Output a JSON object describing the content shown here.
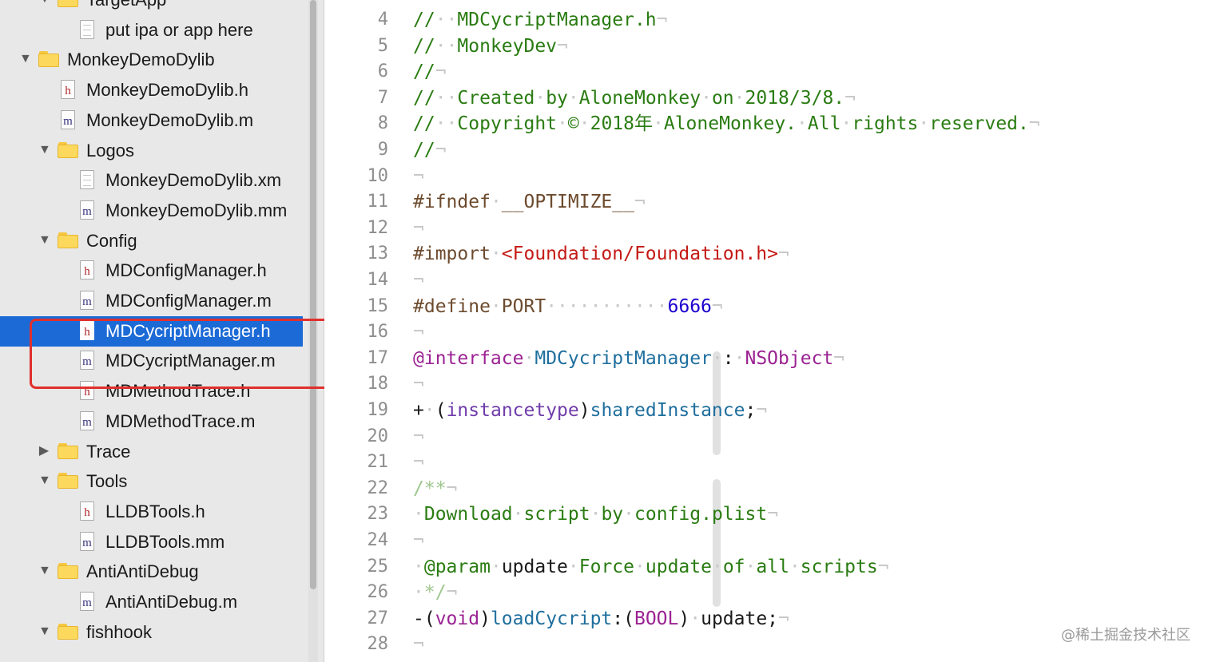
{
  "sidebar": {
    "items": [
      {
        "label": "TargetApp",
        "kind": "folder",
        "expanded": true
      },
      {
        "label": "put ipa or app here",
        "kind": "doc"
      },
      {
        "label": "MonkeyDemoDylib",
        "kind": "folder",
        "expanded": true
      },
      {
        "label": "MonkeyDemoDylib.h",
        "kind": "h",
        "glyph": "h"
      },
      {
        "label": "MonkeyDemoDylib.m",
        "kind": "m",
        "glyph": "m"
      },
      {
        "label": "Logos",
        "kind": "folder",
        "expanded": true
      },
      {
        "label": "MonkeyDemoDylib.xm",
        "kind": "doc"
      },
      {
        "label": "MonkeyDemoDylib.mm",
        "kind": "m",
        "glyph": "m"
      },
      {
        "label": "Config",
        "kind": "folder",
        "expanded": true
      },
      {
        "label": "MDConfigManager.h",
        "kind": "h",
        "glyph": "h"
      },
      {
        "label": "MDConfigManager.m",
        "kind": "m",
        "glyph": "m"
      },
      {
        "label": "MDCycriptManager.h",
        "kind": "h",
        "glyph": "h",
        "selected": true
      },
      {
        "label": "MDCycriptManager.m",
        "kind": "m",
        "glyph": "m"
      },
      {
        "label": "MDMethodTrace.h",
        "kind": "h",
        "glyph": "h"
      },
      {
        "label": "MDMethodTrace.m",
        "kind": "m",
        "glyph": "m"
      },
      {
        "label": "Trace",
        "kind": "folder",
        "expanded": false
      },
      {
        "label": "Tools",
        "kind": "folder",
        "expanded": true
      },
      {
        "label": "LLDBTools.h",
        "kind": "h",
        "glyph": "h"
      },
      {
        "label": "LLDBTools.mm",
        "kind": "m",
        "glyph": "m"
      },
      {
        "label": "AntiAntiDebug",
        "kind": "folder",
        "expanded": true
      },
      {
        "label": "AntiAntiDebug.m",
        "kind": "m",
        "glyph": "m"
      },
      {
        "label": "fishhook",
        "kind": "folder",
        "expanded": true
      }
    ],
    "disclosure": {
      "expanded": "▼",
      "collapsed": "▶"
    }
  },
  "editor": {
    "lines": [
      {
        "no": "4",
        "parts": [
          [
            "cm",
            "//"
          ],
          [
            "inv",
            "··"
          ],
          [
            "cm",
            "MDCycriptManager.h"
          ],
          [
            "inv",
            "¬"
          ]
        ]
      },
      {
        "no": "5",
        "parts": [
          [
            "cm",
            "//"
          ],
          [
            "inv",
            "··"
          ],
          [
            "cm",
            "MonkeyDev"
          ],
          [
            "inv",
            "¬"
          ]
        ]
      },
      {
        "no": "6",
        "parts": [
          [
            "cm",
            "//"
          ],
          [
            "inv",
            "¬"
          ]
        ]
      },
      {
        "no": "7",
        "parts": [
          [
            "cm",
            "//"
          ],
          [
            "inv",
            "··"
          ],
          [
            "cm",
            "Created"
          ],
          [
            "inv",
            "·"
          ],
          [
            "cm",
            "by"
          ],
          [
            "inv",
            "·"
          ],
          [
            "cm",
            "AloneMonkey"
          ],
          [
            "inv",
            "·"
          ],
          [
            "cm",
            "on"
          ],
          [
            "inv",
            "·"
          ],
          [
            "cm",
            "2018/3/8."
          ],
          [
            "inv",
            "¬"
          ]
        ]
      },
      {
        "no": "8",
        "parts": [
          [
            "cm",
            "//"
          ],
          [
            "inv",
            "··"
          ],
          [
            "cm",
            "Copyright"
          ],
          [
            "inv",
            "·"
          ],
          [
            "cm",
            "©"
          ],
          [
            "inv",
            "·"
          ],
          [
            "cm",
            "2018年"
          ],
          [
            "inv",
            "·"
          ],
          [
            "cm",
            "AloneMonkey."
          ],
          [
            "inv",
            "·"
          ],
          [
            "cm",
            "All"
          ],
          [
            "inv",
            "·"
          ],
          [
            "cm",
            "rights"
          ],
          [
            "inv",
            "·"
          ],
          [
            "cm",
            "reserved."
          ],
          [
            "inv",
            "¬"
          ]
        ]
      },
      {
        "no": "9",
        "parts": [
          [
            "cm",
            "//"
          ],
          [
            "inv",
            "¬"
          ]
        ]
      },
      {
        "no": "10",
        "parts": [
          [
            "inv",
            "¬"
          ]
        ]
      },
      {
        "no": "11",
        "parts": [
          [
            "pp",
            "#ifndef"
          ],
          [
            "inv",
            "·"
          ],
          [
            "pp",
            "__OPTIMIZE__"
          ],
          [
            "inv",
            "¬"
          ]
        ]
      },
      {
        "no": "12",
        "parts": [
          [
            "inv",
            "¬"
          ]
        ]
      },
      {
        "no": "13",
        "parts": [
          [
            "pp",
            "#import"
          ],
          [
            "inv",
            "·"
          ],
          [
            "str",
            "<Foundation/Foundation.h>"
          ],
          [
            "inv",
            "¬"
          ]
        ]
      },
      {
        "no": "14",
        "parts": [
          [
            "inv",
            "¬"
          ]
        ]
      },
      {
        "no": "15",
        "parts": [
          [
            "pp",
            "#define"
          ],
          [
            "inv",
            "·"
          ],
          [
            "pp",
            "PORT"
          ],
          [
            "inv",
            "···········"
          ],
          [
            "num",
            "6666"
          ],
          [
            "inv",
            "¬"
          ]
        ]
      },
      {
        "no": "16",
        "parts": [
          [
            "inv",
            "¬"
          ]
        ]
      },
      {
        "no": "17",
        "parts": [
          [
            "kw",
            "@interface"
          ],
          [
            "inv",
            "·"
          ],
          [
            "meth",
            "MDCycriptManager"
          ],
          [
            "inv",
            "·"
          ],
          [
            "plain",
            ":"
          ],
          [
            "inv",
            "·"
          ],
          [
            "kw",
            "NSObject"
          ],
          [
            "inv",
            "¬"
          ]
        ]
      },
      {
        "no": "18",
        "parts": [
          [
            "inv",
            "¬"
          ]
        ]
      },
      {
        "no": "19",
        "parts": [
          [
            "plain",
            "+"
          ],
          [
            "inv",
            "·"
          ],
          [
            "plain",
            "("
          ],
          [
            "cls2",
            "instancetype"
          ],
          [
            "plain",
            ")"
          ],
          [
            "meth",
            "sharedInstance"
          ],
          [
            "plain",
            ";"
          ],
          [
            "inv",
            "¬"
          ]
        ]
      },
      {
        "no": "20",
        "parts": [
          [
            "inv",
            "¬"
          ]
        ]
      },
      {
        "no": "21",
        "parts": [
          [
            "inv",
            "¬"
          ]
        ]
      },
      {
        "no": "22",
        "parts": [
          [
            "cm-light",
            "/**"
          ],
          [
            "inv",
            "¬"
          ]
        ]
      },
      {
        "no": "23",
        "parts": [
          [
            "inv",
            "·"
          ],
          [
            "cm",
            "Download"
          ],
          [
            "inv",
            "·"
          ],
          [
            "cm",
            "script"
          ],
          [
            "inv",
            "·"
          ],
          [
            "cm",
            "by"
          ],
          [
            "inv",
            "·"
          ],
          [
            "cm",
            "config.plist"
          ],
          [
            "inv",
            "¬"
          ]
        ]
      },
      {
        "no": "24",
        "parts": [
          [
            "inv",
            "¬"
          ]
        ]
      },
      {
        "no": "25",
        "parts": [
          [
            "inv",
            "·"
          ],
          [
            "cm",
            "@param"
          ],
          [
            "inv",
            "·"
          ],
          [
            "plain",
            "update"
          ],
          [
            "inv",
            "·"
          ],
          [
            "cm",
            "Force"
          ],
          [
            "inv",
            "·"
          ],
          [
            "cm",
            "update"
          ],
          [
            "inv",
            "·"
          ],
          [
            "cm",
            "of"
          ],
          [
            "inv",
            "·"
          ],
          [
            "cm",
            "all"
          ],
          [
            "inv",
            "·"
          ],
          [
            "cm",
            "scripts"
          ],
          [
            "inv",
            "¬"
          ]
        ]
      },
      {
        "no": "26",
        "parts": [
          [
            "inv",
            "·"
          ],
          [
            "cm-light",
            "*/"
          ],
          [
            "inv",
            "¬"
          ]
        ]
      },
      {
        "no": "27",
        "parts": [
          [
            "plain",
            "-("
          ],
          [
            "kw",
            "void"
          ],
          [
            "plain",
            ")"
          ],
          [
            "meth",
            "loadCycript"
          ],
          [
            "plain",
            ":("
          ],
          [
            "kw",
            "BOOL"
          ],
          [
            "plain",
            ")"
          ],
          [
            "inv",
            "·"
          ],
          [
            "plain",
            "update;"
          ],
          [
            "inv",
            "¬"
          ]
        ]
      },
      {
        "no": "28",
        "parts": [
          [
            "inv",
            "¬"
          ]
        ]
      }
    ]
  },
  "watermark": "@稀土掘金技术社区",
  "colors": {
    "selection": "#1b6ad6",
    "annotation_box": "#e0302d",
    "comment": "#2a7c12",
    "keyword": "#9b2393",
    "string": "#c41a16",
    "number": "#1c00cf",
    "method": "#1f6f9e"
  }
}
